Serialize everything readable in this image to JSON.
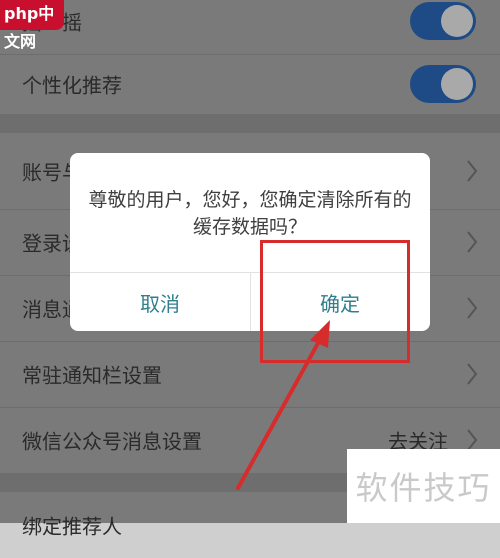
{
  "watermark_logo": "php中文网",
  "settings": {
    "rows": [
      {
        "label": "摇一摇",
        "toggle": true
      },
      {
        "label": "个性化推荐",
        "toggle": true
      },
      {
        "label": "账号与"
      },
      {
        "label": "登录设"
      },
      {
        "label": "消息通"
      },
      {
        "label": "常驻通知栏设置"
      },
      {
        "label": "微信公众号消息设置",
        "value": "去关注"
      },
      {
        "label": "绑定推荐人"
      }
    ]
  },
  "dialog": {
    "message": "尊敬的用户，您好，您确定清除所有的缓存数据吗？",
    "cancel_label": "取消",
    "confirm_label": "确定"
  },
  "overlay_watermark": "软件技巧",
  "colors": {
    "toggle_on": "#1e4b86",
    "dialog_button_text": "#2f7f8f",
    "highlight_red": "#d62c2c"
  }
}
